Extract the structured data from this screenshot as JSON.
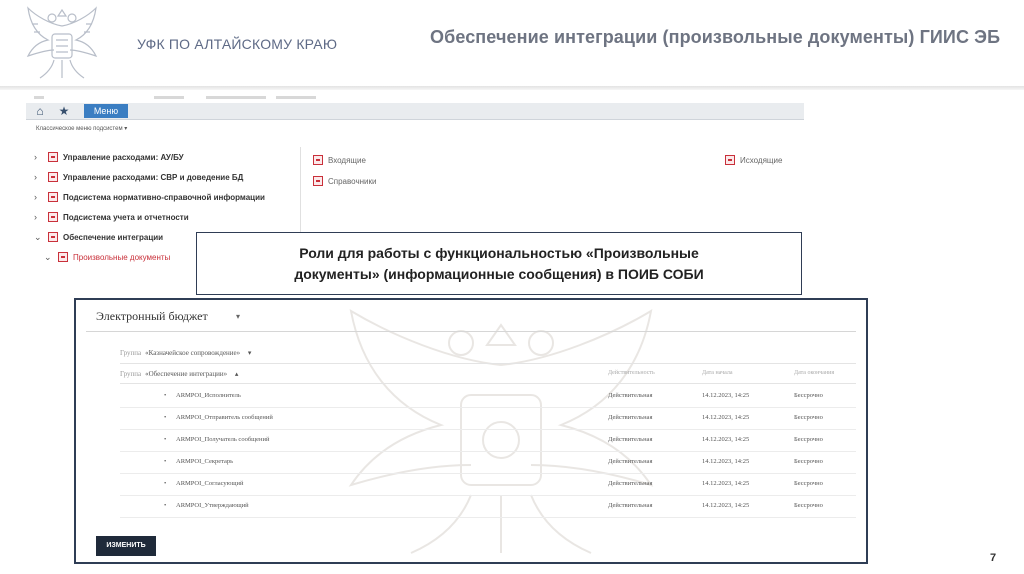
{
  "header": {
    "org": "УФК ПО АЛТАЙСКОМУ КРАЮ",
    "title": "Обеспечение интеграции (произвольные документы) ГИИС ЭБ"
  },
  "top_screenshot": {
    "nav": {
      "menu_label": "Меню",
      "subnav_label": "Классическое меню подсистем ▾"
    },
    "tree": [
      {
        "label": "Управление расходами: АУ/БУ"
      },
      {
        "label": "Управление расходами: СВР и доведение БД"
      },
      {
        "label": "Подсистема нормативно-справочной информации"
      },
      {
        "label": "Подсистема учета и отчетности"
      },
      {
        "label": "Обеспечение интеграции"
      },
      {
        "label": "Произвольные документы"
      }
    ],
    "links": {
      "incoming": "Входящие",
      "outgoing": "Исходящие",
      "references": "Справочники"
    }
  },
  "caption": {
    "line1": "Роли для работы с функциональностью «Произвольные",
    "line2": "документы» (информационные сообщения) в ПОИБ СОБИ"
  },
  "roles_panel": {
    "title": "Электронный бюджет",
    "group1": {
      "label": "Группа",
      "value": "«Казначейское сопровождение»"
    },
    "group2": {
      "label": "Группа",
      "value": "«Обеспечение интеграции»"
    },
    "columns": [
      "Действительность",
      "Дата начала",
      "Дата окончания"
    ],
    "rows": [
      {
        "role": "ARMPOI_Исполнитель",
        "status": "Действительная",
        "start": "14.12.2023, 14:25",
        "end": "Бессрочно"
      },
      {
        "role": "ARMPOI_Отправитель сообщений",
        "status": "Действительная",
        "start": "14.12.2023, 14:25",
        "end": "Бессрочно"
      },
      {
        "role": "ARMPOI_Получатель сообщений",
        "status": "Действительная",
        "start": "14.12.2023, 14:25",
        "end": "Бессрочно"
      },
      {
        "role": "ARMPOI_Секретарь",
        "status": "Действительная",
        "start": "14.12.2023, 14:25",
        "end": "Бессрочно"
      },
      {
        "role": "ARMPOI_Согласующий",
        "status": "Действительная",
        "start": "14.12.2023, 14:25",
        "end": "Бессрочно"
      },
      {
        "role": "ARMPOI_Утверждающий",
        "status": "Действительная",
        "start": "14.12.2023, 14:25",
        "end": "Бессрочно"
      }
    ],
    "button": "ИЗМЕНИТЬ"
  },
  "page_number": "7",
  "icons": {
    "home": "home-icon",
    "star": "star-icon",
    "doc": "document-icon",
    "chevron": "chevron-right-icon"
  },
  "colors": {
    "accent": "#3b7ec2",
    "doc_icon": "#c9303a",
    "panel_border": "#2f3d55"
  }
}
